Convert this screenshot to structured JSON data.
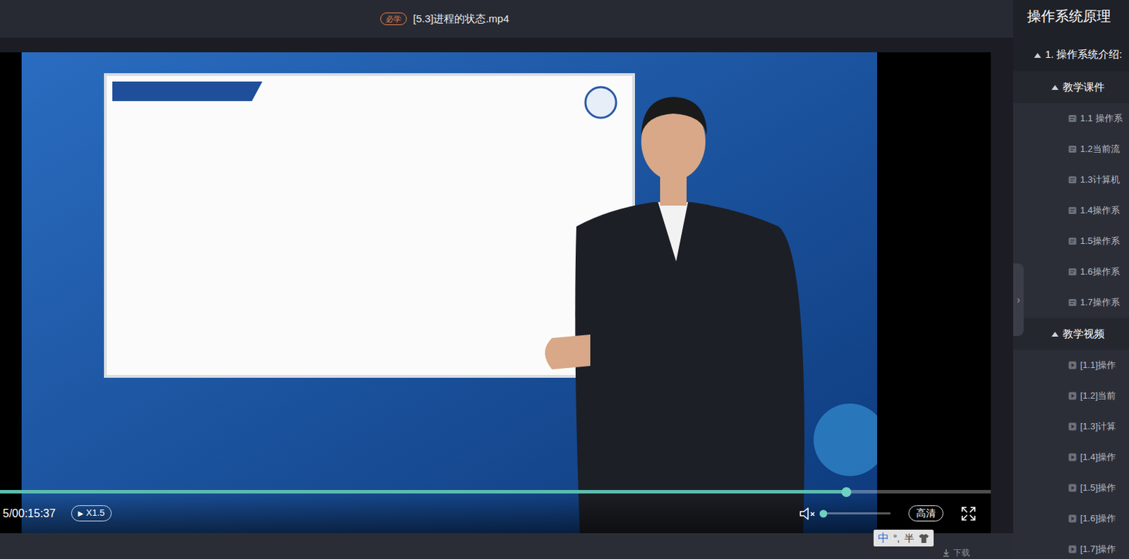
{
  "window": {
    "title": "[5.3]进程的状态.mp4",
    "badge": "必学"
  },
  "player": {
    "progress": {
      "level": 0.854
    },
    "time": "5/00:15:37",
    "speed": {
      "icon": "▶",
      "label": "X1.5"
    },
    "volume": {
      "muted": true,
      "level": 0.04
    },
    "quality": "高清",
    "download": {
      "label": "下载"
    }
  },
  "sidebar": {
    "title": "操作系统原理",
    "toggle": "›",
    "chapters": [
      {
        "label": "1. 操作系统介绍:",
        "expanded": true,
        "sections": [
          {
            "label": "教学课件",
            "expanded": true,
            "kind": "doc",
            "items": [
              {
                "label": "1.1 操作系"
              },
              {
                "label": "1.2当前流"
              },
              {
                "label": "1.3计算机"
              },
              {
                "label": "1.4操作系"
              },
              {
                "label": "1.5操作系"
              },
              {
                "label": "1.6操作系"
              },
              {
                "label": "1.7操作系"
              }
            ]
          },
          {
            "label": "教学视频",
            "expanded": true,
            "kind": "video",
            "items": [
              {
                "label": "[1.1]操作"
              },
              {
                "label": "[1.2]当前"
              },
              {
                "label": "[1.3]计算"
              },
              {
                "label": "[1.4]操作"
              },
              {
                "label": "[1.5]操作"
              },
              {
                "label": "[1.6]操作"
              },
              {
                "label": "[1.7]操作"
              }
            ]
          }
        ]
      }
    ]
  },
  "ime": {
    "mode": "中",
    "punct": "°,",
    "width": "半"
  }
}
